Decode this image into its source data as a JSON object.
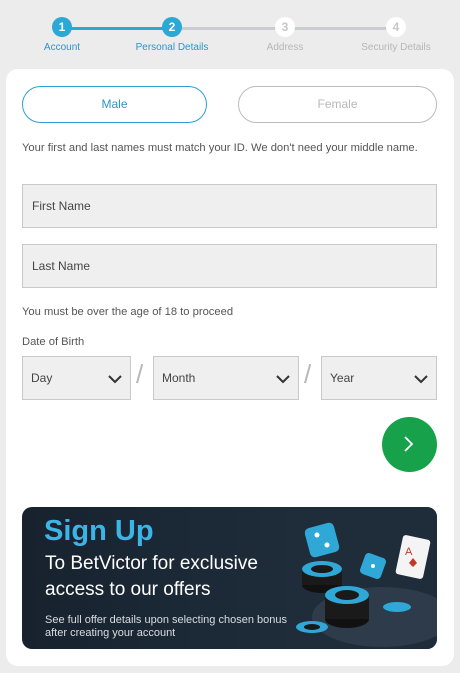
{
  "stepper": {
    "steps": [
      {
        "number": "1",
        "label": "Account",
        "state": "active"
      },
      {
        "number": "2",
        "label": "Personal Details",
        "state": "active"
      },
      {
        "number": "3",
        "label": "Address",
        "state": "inactive"
      },
      {
        "number": "4",
        "label": "Security Details",
        "state": "inactive"
      }
    ]
  },
  "gender": {
    "male": "Male",
    "female": "Female",
    "selected": "Male"
  },
  "name_note": "Your first and last names must match your ID. We don't need your middle name.",
  "fields": {
    "first_name": "First Name",
    "last_name": "Last Name"
  },
  "age_note": "You must be over the age of 18 to proceed",
  "dob": {
    "label": "Date of Birth",
    "day": "Day",
    "month": "Month",
    "year": "Year"
  },
  "banner": {
    "title": "Sign Up",
    "subtitle": "To BetVictor for exclusive access to our offers",
    "fine_print": "See full offer details upon selecting chosen bonus after creating your account"
  },
  "colors": {
    "accent": "#2aa8d6",
    "next_button": "#16a14a",
    "banner_title": "#3cb5e6"
  }
}
